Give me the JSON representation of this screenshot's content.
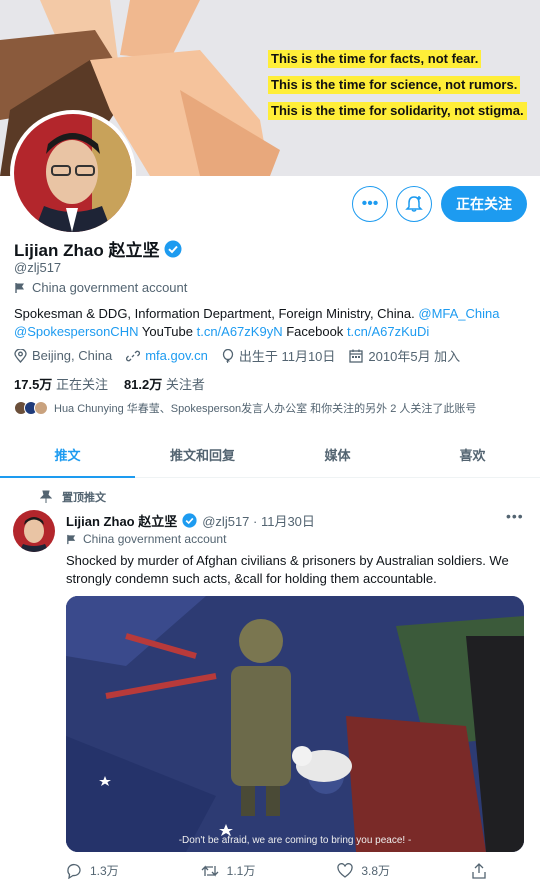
{
  "banner": {
    "slogans": [
      "This is the time for facts, not fear.",
      "This is the time for science, not rumors.",
      "This is the time for solidarity, not stigma."
    ]
  },
  "actions": {
    "follow_label": "正在关注"
  },
  "profile": {
    "name": "Lijian Zhao 赵立坚",
    "handle": "@zlj517",
    "gov_label": "China government account",
    "bio_text": "Spokesman & DDG, Information Department, Foreign Ministry, China.",
    "bio_mention1": "@MFA_China",
    "bio_mention2": "@SpokespersonCHN",
    "bio_youtube_label": "YouTube",
    "bio_youtube_link": "t.cn/A67zK9yN",
    "bio_facebook_label": "Facebook",
    "bio_facebook_link": "t.cn/A67zKuDi",
    "location": "Beijing, China",
    "website": "mfa.gov.cn",
    "birthday": "出生于 11月10日",
    "joined": "2010年5月 加入",
    "following_count": "17.5万",
    "following_label": "正在关注",
    "followers_count": "81.2万",
    "followers_label": "关注者",
    "followed_by": "Hua Chunying 华春莹、Spokesperson发言人办公室 和你关注的另外 2 人关注了此账号"
  },
  "tabs": [
    {
      "label": "推文"
    },
    {
      "label": "推文和回复"
    },
    {
      "label": "媒体"
    },
    {
      "label": "喜欢"
    }
  ],
  "tweet": {
    "pinned_label": "置顶推文",
    "name": "Lijian Zhao 赵立坚",
    "handle_date": "@zlj517 · 11月30日",
    "gov_label": "China government account",
    "text": "Shocked by murder of Afghan civilians & prisoners by Australian soldiers. We strongly condemn such acts, &call for holding them accountable.",
    "media_caption": "-Don't be afraid, we are coming to bring you peace! -",
    "replies": "1.3万",
    "retweets": "1.1万",
    "likes": "3.8万"
  },
  "colors": {
    "accent": "#1d9bf0",
    "slogan_highlight": "#ffee38"
  }
}
